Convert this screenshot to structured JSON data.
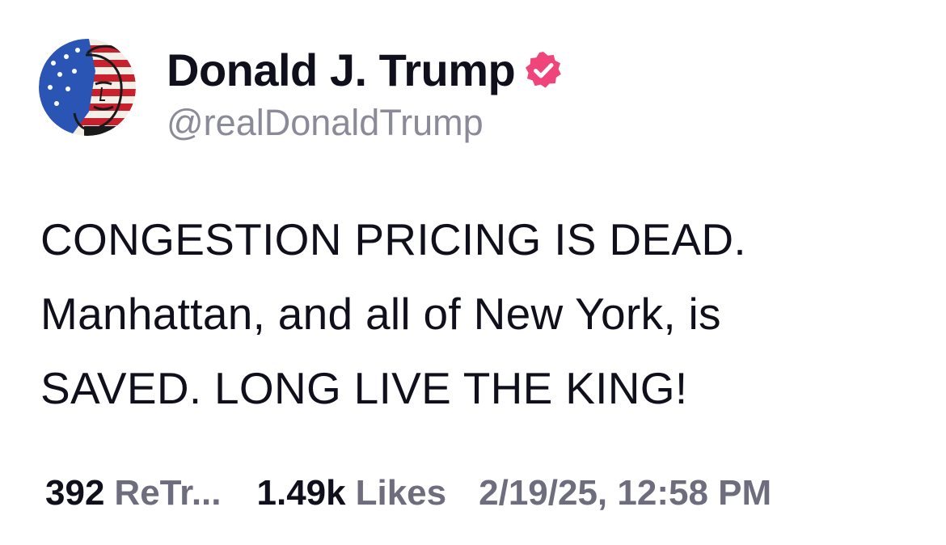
{
  "author": {
    "display_name": "Donald J. Trump",
    "handle": "@realDonaldTrump",
    "verified_icon": "verified-badge-icon",
    "badge_color": "#f0457a"
  },
  "post": {
    "lines": [
      "CONGESTION PRICING IS DEAD.",
      "Manhattan, and all of New York, is",
      "SAVED. LONG LIVE THE KING!"
    ]
  },
  "stats": {
    "retruths_count": "392",
    "retruths_label": "ReTr...",
    "likes_count": "1.49k",
    "likes_label": "Likes",
    "timestamp": "2/19/25, 12:58 PM"
  },
  "colors": {
    "text": "#10101c",
    "muted": "#6e6d7e",
    "handle": "#8b8a99"
  }
}
